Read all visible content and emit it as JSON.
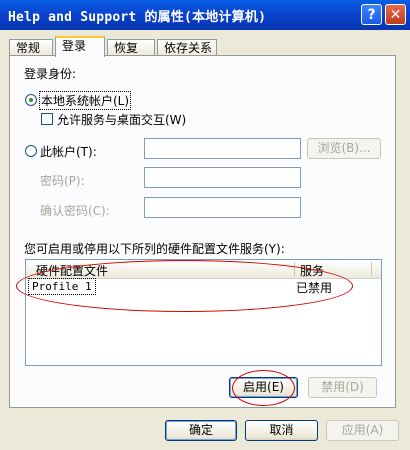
{
  "window": {
    "title": "Help and Support 的属性(本地计算机)",
    "help_glyph": "?",
    "close_glyph": "✕"
  },
  "tabs": [
    {
      "label": "常规",
      "active": false
    },
    {
      "label": "登录",
      "active": true
    },
    {
      "label": "恢复",
      "active": false
    },
    {
      "label": "依存关系",
      "active": false
    }
  ],
  "logon": {
    "section_label": "登录身份:",
    "local_system_label": "本地系统帐户(L)",
    "allow_desktop_label": "允许服务与桌面交互(W)",
    "this_account_label": "此帐户(T):",
    "browse_label": "浏览(B)...",
    "password_label": "密码(P):",
    "confirm_password_label": "确认密码(C):",
    "account_value": "",
    "password_value": "",
    "confirm_value": ""
  },
  "profiles": {
    "caption": "您可启用或停用以下所列的硬件配置文件服务(Y):",
    "columns": [
      "硬件配置文件",
      "服务"
    ],
    "rows": [
      {
        "profile": "Profile 1",
        "service": "已禁用"
      }
    ],
    "enable_label": "启用(E)",
    "disable_label": "禁用(D)"
  },
  "footer": {
    "ok_label": "确定",
    "cancel_label": "取消",
    "apply_label": "应用(A)"
  },
  "colors": {
    "titlebar": "#0a3fc8",
    "annotation": "#d40000",
    "selected_radio": "#21a121"
  }
}
